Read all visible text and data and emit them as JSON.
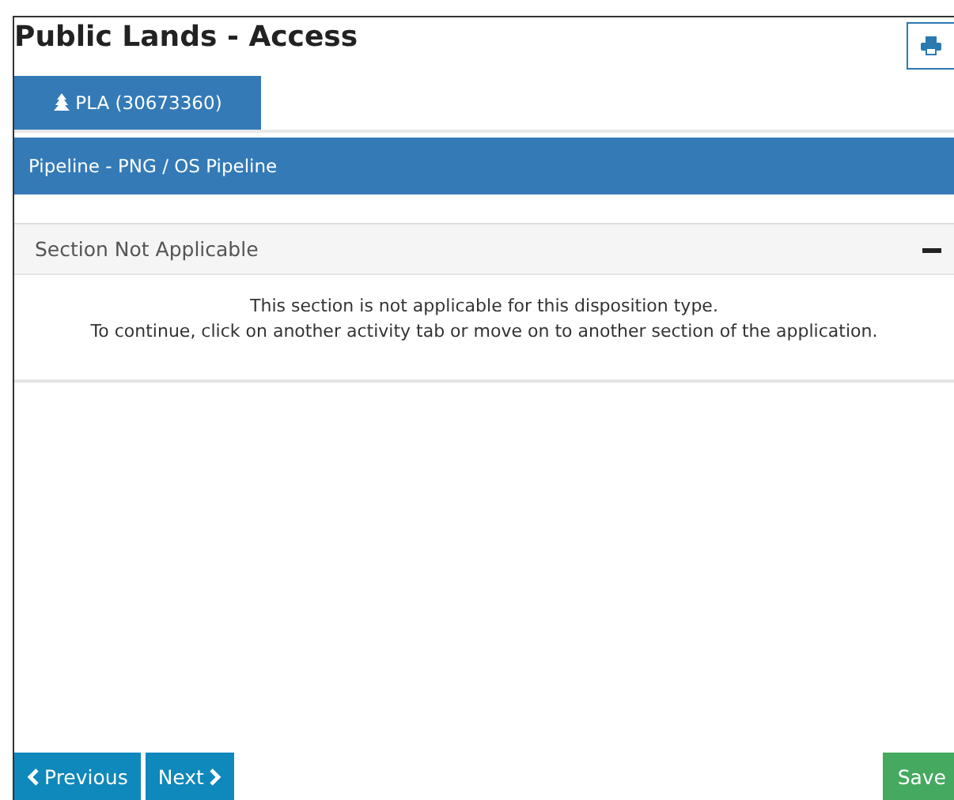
{
  "title": "Public Lands - Access",
  "tabs": [
    {
      "label": "PLA (30673360)",
      "selected": true
    }
  ],
  "activity": "Pipeline - PNG / OS Pipeline",
  "section": {
    "title": "Section Not Applicable",
    "expanded": true,
    "lines": [
      "This section is not applicable for this disposition type.",
      "To continue, click on another activity tab or move on to another section of the application."
    ]
  },
  "nav_buttons": [
    {
      "kind": "previous",
      "label": "Previous"
    },
    {
      "kind": "next",
      "label": "Next"
    }
  ],
  "save_button": "Save"
}
